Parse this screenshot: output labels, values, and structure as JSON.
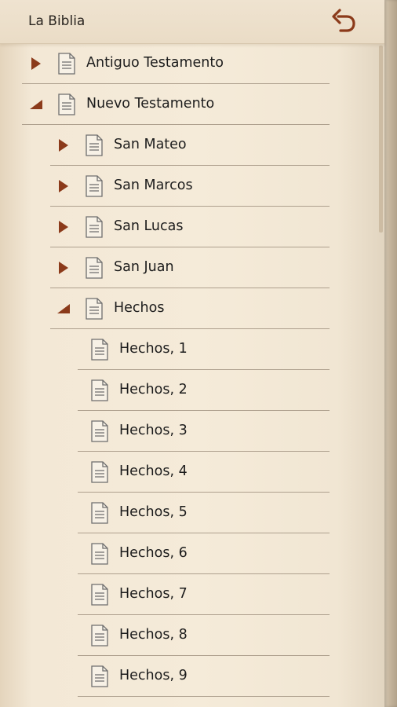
{
  "header": {
    "title": "La Biblia",
    "back_icon": "undo-arrow-icon"
  },
  "colors": {
    "accent": "#8b3a1a",
    "line": "#aea08e"
  },
  "tree": {
    "antiguo": "Antiguo Testamento",
    "nuevo": "Nuevo Testamento",
    "mateo": "San Mateo",
    "marcos": "San Marcos",
    "lucas": "San Lucas",
    "juan": "San Juan",
    "hechos": "Hechos",
    "chapters": [
      "Hechos, 1",
      "Hechos, 2",
      "Hechos, 3",
      "Hechos, 4",
      "Hechos, 5",
      "Hechos, 6",
      "Hechos, 7",
      "Hechos, 8",
      "Hechos, 9"
    ]
  }
}
